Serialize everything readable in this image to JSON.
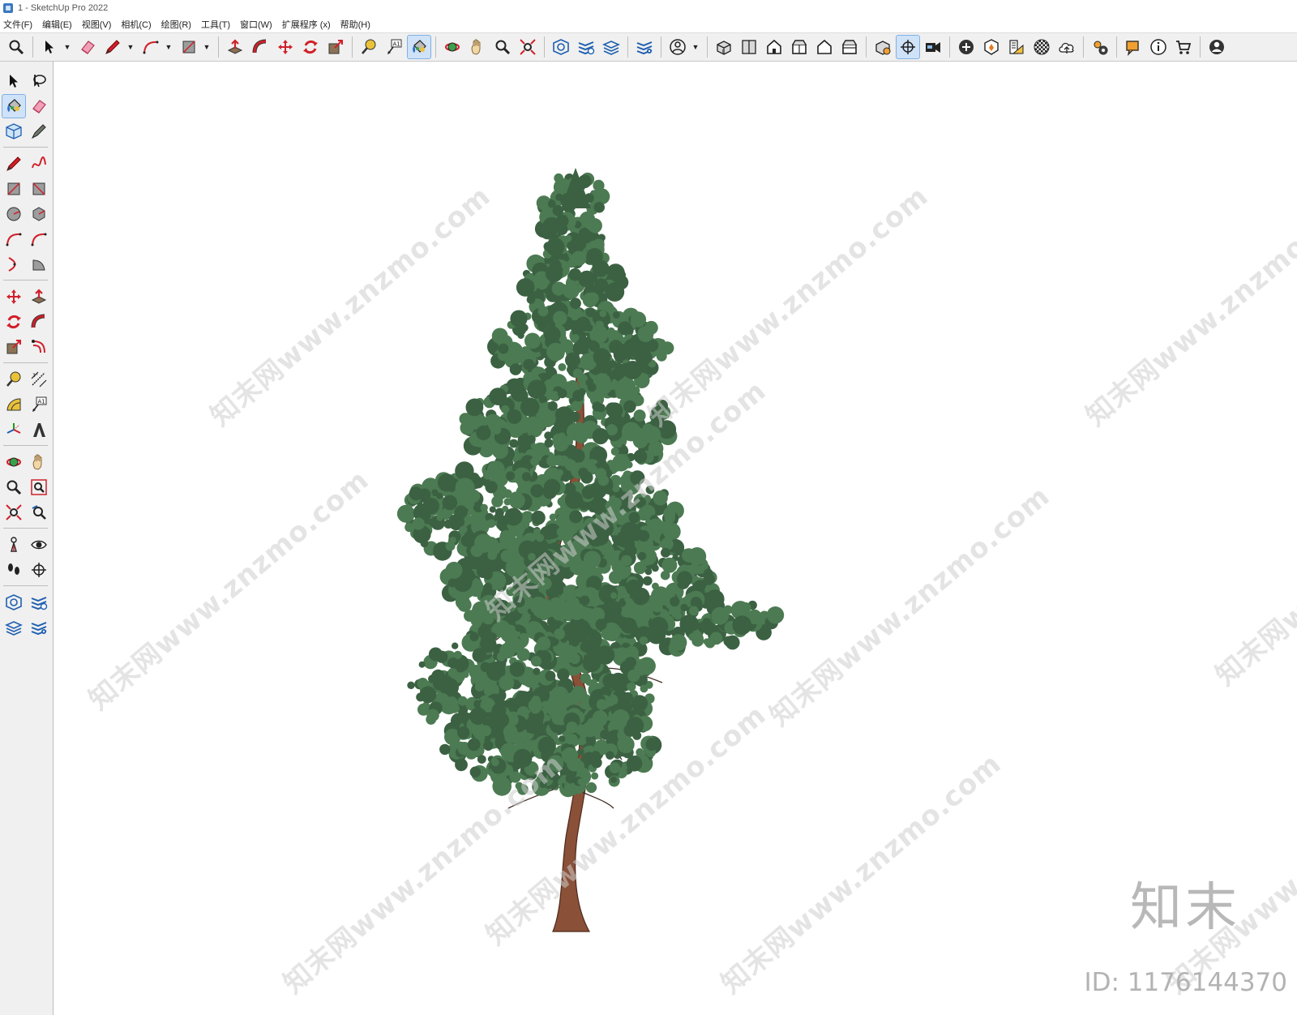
{
  "window": {
    "title": "1 - SketchUp Pro 2022"
  },
  "menu": [
    "文件(F)",
    "编辑(E)",
    "视图(V)",
    "相机(C)",
    "绘图(R)",
    "工具(T)",
    "窗口(W)",
    "扩展程序 (x)",
    "帮助(H)"
  ],
  "toolbar": {
    "groups": [
      [
        "zoom-icon"
      ],
      [
        "select-arrow-icon",
        "dropdown",
        "eraser-icon",
        "pencil-icon",
        "dropdown",
        "arc-icon",
        "dropdown",
        "rectangle-icon",
        "dropdown"
      ],
      [
        "push-pull-icon",
        "follow-me-icon",
        "move-icon",
        "rotate-icon",
        "scale-icon"
      ],
      [
        "tape-measure-icon",
        "text-label-icon",
        "paint-bucket-icon"
      ],
      [
        "orbit-icon",
        "pan-icon",
        "zoom-tool-icon",
        "zoom-extents-icon"
      ],
      [
        "warehouse-icon",
        "extension-warehouse-icon",
        "layout-icon"
      ],
      [
        "extension-manager-icon"
      ],
      [
        "account-icon",
        "dropdown"
      ],
      [
        "iso-view-icon",
        "top-view-icon",
        "front-view-icon",
        "right-view-icon",
        "back-view-icon",
        "left-view-icon"
      ],
      [
        "solid-tools-icon",
        "section-plane-icon",
        "scenes-icon"
      ],
      [
        "add-location-icon",
        "sandbox-icon",
        "styles-icon",
        "shadow-icon",
        "cloud-icon"
      ],
      [
        "settings-icon"
      ],
      [
        "comment-icon",
        "info-icon",
        "cart-icon"
      ],
      [
        "profile-icon"
      ]
    ],
    "active": [
      "paint-bucket-icon",
      "section-plane-icon"
    ]
  },
  "left_toolbar": {
    "rows": [
      [
        "select-arrow-icon",
        "lasso-select-icon"
      ],
      [
        "paint-bucket-icon",
        "eraser-icon"
      ],
      [
        "make-component-icon",
        "tag-tool-icon"
      ],
      "sep",
      [
        "pencil-icon",
        "freehand-icon"
      ],
      [
        "rectangle-icon",
        "rotated-rectangle-icon"
      ],
      [
        "circle-icon",
        "polygon-icon"
      ],
      [
        "arc-icon",
        "two-point-arc-icon"
      ],
      [
        "three-point-arc-icon",
        "pie-icon"
      ],
      "sep",
      [
        "move-icon",
        "push-pull-icon"
      ],
      [
        "rotate-icon",
        "follow-me-icon"
      ],
      [
        "scale-icon",
        "offset-icon"
      ],
      "sep",
      [
        "tape-measure-icon",
        "dimension-icon"
      ],
      [
        "protractor-icon",
        "text-label-icon"
      ],
      [
        "axes-icon",
        "3d-text-icon"
      ],
      "sep",
      [
        "orbit-icon",
        "pan-icon"
      ],
      [
        "zoom-tool-icon",
        "zoom-window-icon"
      ],
      [
        "zoom-extents-icon",
        "previous-view-icon"
      ],
      "sep",
      [
        "position-camera-icon",
        "look-around-icon"
      ],
      [
        "walk-icon",
        "section-plane-icon"
      ],
      "sep",
      [
        "warehouse-icon",
        "extension-warehouse-icon"
      ],
      [
        "layout-icon",
        "extension-manager-icon"
      ]
    ],
    "active": [
      "paint-bucket-icon"
    ]
  },
  "watermark": {
    "text": "知末网www.znzmo.com"
  },
  "brand": {
    "name": "知末",
    "id_text": "ID: 1176144370"
  },
  "colors": {
    "foliage": "#4c7a52",
    "foliage_dark": "#3b6142",
    "trunk": "#8a5038",
    "accent_red": "#d0202a",
    "accent_blue": "#1e5fb0"
  }
}
